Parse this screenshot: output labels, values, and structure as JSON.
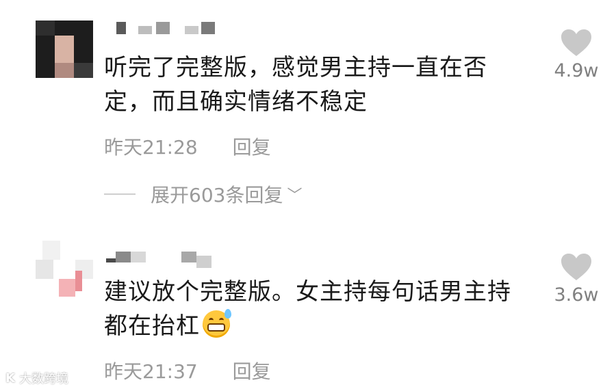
{
  "comments": [
    {
      "text": "听完了完整版，感觉男主持一直在否定，而且确实情绪不稳定",
      "time": "昨天21:28",
      "reply_label": "回复",
      "likes": "4.9w",
      "expand_label": "展开603条回复"
    },
    {
      "text": "建议放个完整版。女主持每句话男主持都在抬杠",
      "time": "昨天21:37",
      "reply_label": "回复",
      "likes": "3.6w"
    }
  ],
  "watermark": {
    "logo": "K",
    "text": "大数跨境"
  },
  "icons": {
    "like": "heart-icon",
    "expand": "chevron-down-icon",
    "emoji": "grinning-sweat-emoji-icon"
  },
  "colors": {
    "text": "#1a1a1a",
    "meta": "#9a9a9a",
    "like": "#c8c8c8"
  }
}
